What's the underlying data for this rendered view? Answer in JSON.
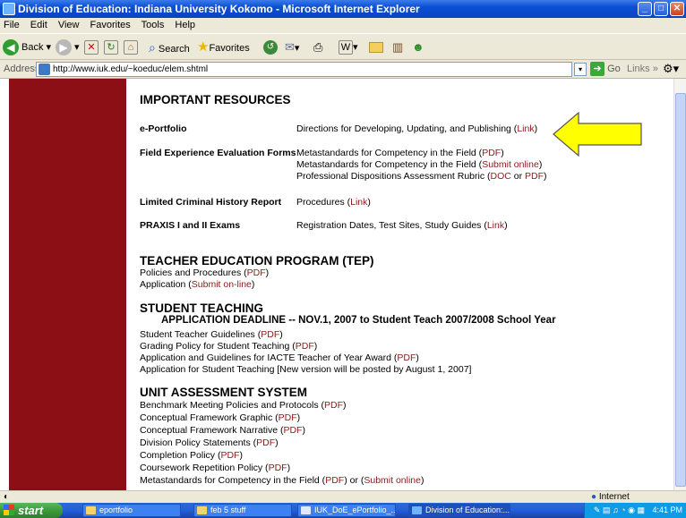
{
  "window": {
    "title": "Division of Education: Indiana University Kokomo - Microsoft Internet Explorer"
  },
  "menu": [
    "File",
    "Edit",
    "View",
    "Favorites",
    "Tools",
    "Help"
  ],
  "toolbar": {
    "back": "Back",
    "search": "Search",
    "favorites": "Favorites"
  },
  "address": {
    "label": "Address",
    "url": "http://www.iuk.edu/~koeduc/elem.shtml",
    "go": "Go",
    "links": "Links"
  },
  "page": {
    "important_heading": "IMPORTANT RESOURCES",
    "resources": [
      {
        "label": "e-Portfolio",
        "lines": [
          {
            "text": "Directions for Developing, Updating, and Publishing (",
            "link": "Link",
            "tail": ")"
          }
        ]
      },
      {
        "label": "Field Experience Evaluation Forms",
        "lines": [
          {
            "text": "Metastandards for Competency in the Field (",
            "link": "PDF",
            "tail": ")"
          },
          {
            "text": "Metastandards for Competency in the Field (",
            "link": "Submit online",
            "tail": ")"
          },
          {
            "text": "Professional Dispositions Assessment Rubric (",
            "link": "DOC",
            "mid": " or ",
            "link2": "PDF",
            "tail": ")"
          }
        ]
      },
      {
        "label": "Limited Criminal History Report",
        "lines": [
          {
            "text": "Procedures (",
            "link": "Link",
            "tail": ")"
          }
        ]
      },
      {
        "label": "PRAXIS I and II Exams",
        "lines": [
          {
            "text": "Registration Dates, Test Sites, Study Guides (",
            "link": "Link",
            "tail": ")"
          }
        ]
      }
    ],
    "tep": {
      "heading": "TEACHER EDUCATION PROGRAM (TEP)",
      "lines": [
        {
          "text": "Policies and Procedures (",
          "link": "PDF",
          "tail": ")"
        },
        {
          "text": "Application (",
          "link": "Submit on-line",
          "tail": ")"
        }
      ]
    },
    "student_teaching": {
      "heading": "STUDENT TEACHING",
      "deadline": "APPLICATION DEADLINE -- NOV.1, 2007 to Student Teach 2007/2008 School Year",
      "lines": [
        {
          "text": "Student Teacher Guidelines (",
          "link": "PDF",
          "tail": ")"
        },
        {
          "text": "Grading Policy for Student Teaching (",
          "link": "PDF",
          "tail": ")"
        },
        {
          "text": "Application and Guidelines for IACTE Teacher of Year Award (",
          "link": "PDF",
          "tail": ")"
        },
        {
          "text": "Application for Student Teaching [New version will be posted by August 1, 2007]",
          "link": "",
          "tail": ""
        }
      ]
    },
    "unit_assessment": {
      "heading": "UNIT ASSESSMENT SYSTEM",
      "lines": [
        {
          "text": "Benchmark Meeting Policies and Protocols (",
          "link": "PDF",
          "tail": ")"
        },
        {
          "text": "Conceptual Framework Graphic (",
          "link": "PDF",
          "tail": ")"
        },
        {
          "text": "Conceptual Framework Narrative (",
          "link": "PDF",
          "tail": ")"
        },
        {
          "text": "Division Policy Statements (",
          "link": "PDF",
          "tail": ")"
        },
        {
          "text": "Completion Policy (",
          "link": "PDF",
          "tail": ")"
        },
        {
          "text": "Coursework Repetition Policy (",
          "link": "PDF",
          "tail": ")"
        },
        {
          "text": "Metastandards for Competency in the Field (",
          "link": "PDF",
          "mid": ") or (",
          "link2": "Submit online",
          "tail": ")"
        }
      ]
    }
  },
  "status": {
    "zone": "Internet"
  },
  "taskbar": {
    "start": "start",
    "tasks": [
      "eportfolio",
      "feb 5 stuff",
      "IUK_DoE_ePortfolio_...",
      "Division of Education:..."
    ],
    "clock": "4:41 PM"
  },
  "colors": {
    "sidebar": "#8b0f14",
    "link": "#8b1a1a",
    "arrow": "#ffff00"
  }
}
